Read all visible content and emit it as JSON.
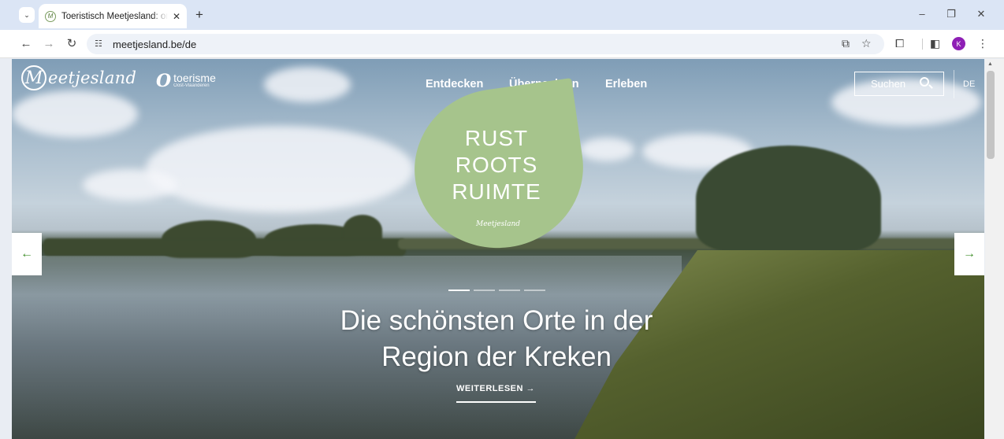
{
  "browser": {
    "tab_title": "Toeristisch Meetjesland: ontdekken",
    "tab_favicon": "M",
    "tab_close": "✕",
    "new_tab": "+",
    "tab_menu": "⌄",
    "minimize": "–",
    "restore": "❐",
    "close": "✕",
    "url": "meetjesland.be/de",
    "profile_initial": "K"
  },
  "site": {
    "logo_initial": "M",
    "logo_text": "eetjesland",
    "partner_logo_glyph": "O",
    "partner_logo_word": "toerisme",
    "partner_logo_sub": "Oost-Vlaanderen",
    "nav": [
      "Entdecken",
      "Übernachten",
      "Erleben"
    ],
    "search_label": "Suchen",
    "language": "DE"
  },
  "hero": {
    "leaf_lines": [
      "RUST",
      "ROOTS",
      "RUIMTE"
    ],
    "leaf_signature": "Meetjesland",
    "headline": "Die schönsten Orte in der Region der Kreken",
    "cta": "WEITERLESEN  →",
    "slide_count": 4,
    "active_slide": 1,
    "prev_arrow": "←",
    "next_arrow": "→"
  },
  "colors": {
    "leaf": "#a6c48c",
    "arrow_icon": "#3f8f2a",
    "tabstrip": "#dbe5f5",
    "profile": "#8e1fb5"
  }
}
